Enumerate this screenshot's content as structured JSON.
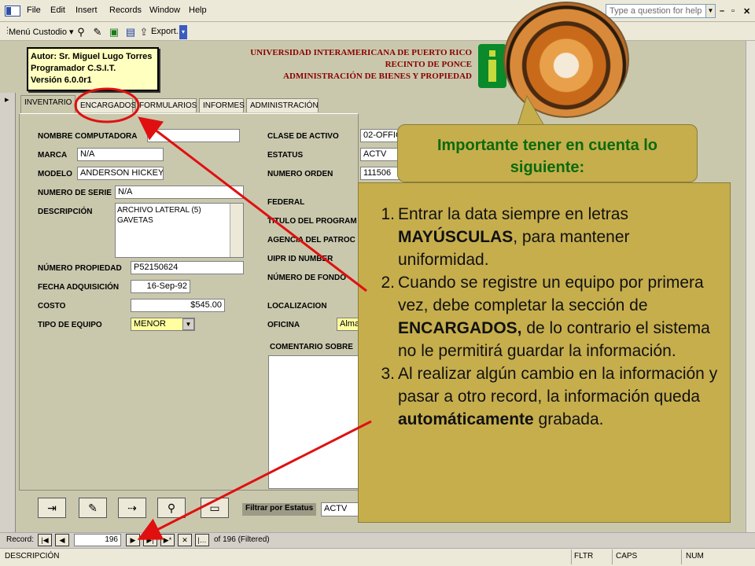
{
  "menu": [
    "File",
    "Edit",
    "Insert",
    "Records",
    "Window",
    "Help"
  ],
  "help_placeholder": "Type a question for help",
  "toolbar": {
    "menu_custodio": "Menú Custodio ▾",
    "export": "Export..."
  },
  "author": [
    "Autor:  Sr. Miguel Lugo Torres",
    "Programador C.S.I.T.",
    "Versión 6.0.0r1"
  ],
  "university": [
    "UNIVERSIDAD INTERAMERICANA DE PUERTO RICO",
    "RECINTO DE PONCE",
    "ADMINISTRACIÓN DE BIENES Y PROPIEDAD"
  ],
  "tabs": [
    "INVENTARIO",
    "ENCARGADOS",
    "FORMULARIOS",
    "INFORMES",
    "ADMINISTRACIÓN"
  ],
  "left_labels": [
    "NOMBRE COMPUTADORA",
    "MARCA",
    "MODELO",
    "NUMERO DE SERIE",
    "DESCRIPCIÓN",
    "NÚMERO PROPIEDAD",
    "FECHA ADQUISICIÓN",
    "COSTO",
    "TIPO DE EQUIPO"
  ],
  "left_values": {
    "marca": "N/A",
    "modelo": "ANDERSON HICKEY",
    "serie": "N/A",
    "descripcion": "ARCHIVO LATERAL     (5)\nGAVETAS",
    "propiedad": "P52150624",
    "fecha": "16-Sep-92",
    "costo": "$545.00",
    "tipo": "MENOR"
  },
  "right_labels": [
    "CLASE DE ACTIVO",
    "ESTATUS",
    "NUMERO ORDEN",
    "FEDERAL",
    "TITULO DEL PROGRAM",
    "AGENCIA DEL PATROC",
    "UIPR ID NUMBER",
    "NÚMERO DE FONDO",
    "LOCALIZACION",
    "OFICINA",
    "COMENTARIO SOBRE"
  ],
  "right_values": {
    "clase": "02-OFFIC",
    "estatus": "ACTV",
    "orden": "111506",
    "oficina": "Alma"
  },
  "filter": {
    "label": "Filtrar por Estatus",
    "value": "ACTV"
  },
  "record": {
    "label": "Record:",
    "current": "196",
    "of": "of  196 (Filtered)"
  },
  "status": {
    "field": "DESCRIPCIÓN",
    "fltr": "FLTR",
    "caps": "CAPS",
    "num": "NUM"
  },
  "callout": {
    "title": "Importante tener en cuenta lo siguiente:",
    "items": [
      {
        "num": "1.",
        "parts": [
          "Entrar la data siempre en letras ",
          "MAYÚSCULAS",
          ", para mantener uniformidad."
        ]
      },
      {
        "num": "2.",
        "parts": [
          "Cuando se registre un equipo por primera vez, debe completar la sección de ",
          "ENCARGADOS,",
          " de lo contrario el sistema no le permitirá guardar la información."
        ]
      },
      {
        "num": "3.",
        "parts": [
          "Al realizar algún cambio en la información y pasar a otro record, la información queda ",
          "automáticamente",
          " grabada."
        ]
      }
    ]
  },
  "colors": {
    "callout": "#c6ae4d",
    "callout_title": "#0b6a0b",
    "arrow": "#e01010",
    "form_bg": "#c9c8ad",
    "univ_text": "#8a0000"
  }
}
